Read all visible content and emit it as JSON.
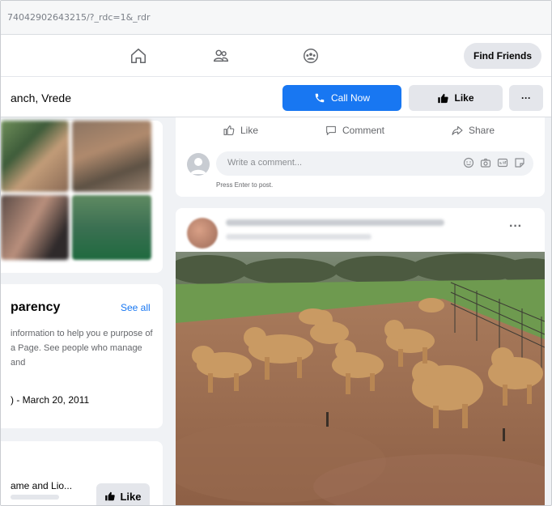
{
  "browser": {
    "url": "74042902643215/?_rdc=1&_rdr"
  },
  "nav": {
    "icons": [
      "home-icon",
      "friends-icon",
      "groups-icon"
    ],
    "find_friends_label": "Find Friends"
  },
  "page_header": {
    "page_name": "anch, Vrede",
    "call_now_label": "Call Now",
    "like_label": "Like",
    "more_label": "···"
  },
  "transparency": {
    "title": "parency",
    "see_all_label": "See all",
    "description": "information to help you e purpose of a Page. See people who manage and",
    "date": ") - March 20, 2011"
  },
  "related_page": {
    "name": "ame and Lio...",
    "like_label": "Like"
  },
  "post1": {
    "actions": {
      "like": "Like",
      "comment": "Comment",
      "share": "Share"
    },
    "comment_placeholder": "Write a comment...",
    "hint": "Press Enter to post."
  },
  "post2": {
    "more_label": "···"
  },
  "colors": {
    "accent": "#1877f2",
    "button_grey": "#e4e6eb",
    "page_bg": "#f0f2f5"
  }
}
